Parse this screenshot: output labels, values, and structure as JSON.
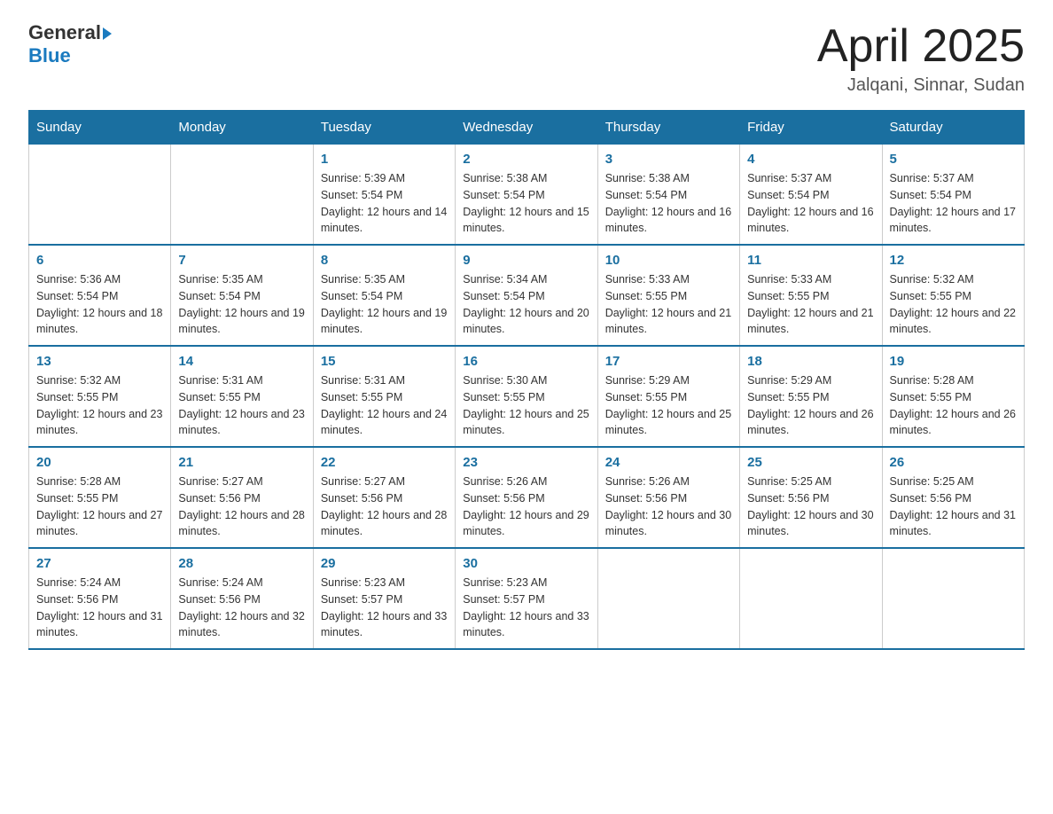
{
  "header": {
    "logo_text_general": "General",
    "logo_text_blue": "Blue",
    "main_title": "April 2025",
    "subtitle": "Jalqani, Sinnar, Sudan"
  },
  "calendar": {
    "days_of_week": [
      "Sunday",
      "Monday",
      "Tuesday",
      "Wednesday",
      "Thursday",
      "Friday",
      "Saturday"
    ],
    "weeks": [
      [
        {
          "day": "",
          "info": ""
        },
        {
          "day": "",
          "info": ""
        },
        {
          "day": "1",
          "sunrise": "5:39 AM",
          "sunset": "5:54 PM",
          "daylight": "12 hours and 14 minutes."
        },
        {
          "day": "2",
          "sunrise": "5:38 AM",
          "sunset": "5:54 PM",
          "daylight": "12 hours and 15 minutes."
        },
        {
          "day": "3",
          "sunrise": "5:38 AM",
          "sunset": "5:54 PM",
          "daylight": "12 hours and 16 minutes."
        },
        {
          "day": "4",
          "sunrise": "5:37 AM",
          "sunset": "5:54 PM",
          "daylight": "12 hours and 16 minutes."
        },
        {
          "day": "5",
          "sunrise": "5:37 AM",
          "sunset": "5:54 PM",
          "daylight": "12 hours and 17 minutes."
        }
      ],
      [
        {
          "day": "6",
          "sunrise": "5:36 AM",
          "sunset": "5:54 PM",
          "daylight": "12 hours and 18 minutes."
        },
        {
          "day": "7",
          "sunrise": "5:35 AM",
          "sunset": "5:54 PM",
          "daylight": "12 hours and 19 minutes."
        },
        {
          "day": "8",
          "sunrise": "5:35 AM",
          "sunset": "5:54 PM",
          "daylight": "12 hours and 19 minutes."
        },
        {
          "day": "9",
          "sunrise": "5:34 AM",
          "sunset": "5:54 PM",
          "daylight": "12 hours and 20 minutes."
        },
        {
          "day": "10",
          "sunrise": "5:33 AM",
          "sunset": "5:55 PM",
          "daylight": "12 hours and 21 minutes."
        },
        {
          "day": "11",
          "sunrise": "5:33 AM",
          "sunset": "5:55 PM",
          "daylight": "12 hours and 21 minutes."
        },
        {
          "day": "12",
          "sunrise": "5:32 AM",
          "sunset": "5:55 PM",
          "daylight": "12 hours and 22 minutes."
        }
      ],
      [
        {
          "day": "13",
          "sunrise": "5:32 AM",
          "sunset": "5:55 PM",
          "daylight": "12 hours and 23 minutes."
        },
        {
          "day": "14",
          "sunrise": "5:31 AM",
          "sunset": "5:55 PM",
          "daylight": "12 hours and 23 minutes."
        },
        {
          "day": "15",
          "sunrise": "5:31 AM",
          "sunset": "5:55 PM",
          "daylight": "12 hours and 24 minutes."
        },
        {
          "day": "16",
          "sunrise": "5:30 AM",
          "sunset": "5:55 PM",
          "daylight": "12 hours and 25 minutes."
        },
        {
          "day": "17",
          "sunrise": "5:29 AM",
          "sunset": "5:55 PM",
          "daylight": "12 hours and 25 minutes."
        },
        {
          "day": "18",
          "sunrise": "5:29 AM",
          "sunset": "5:55 PM",
          "daylight": "12 hours and 26 minutes."
        },
        {
          "day": "19",
          "sunrise": "5:28 AM",
          "sunset": "5:55 PM",
          "daylight": "12 hours and 26 minutes."
        }
      ],
      [
        {
          "day": "20",
          "sunrise": "5:28 AM",
          "sunset": "5:55 PM",
          "daylight": "12 hours and 27 minutes."
        },
        {
          "day": "21",
          "sunrise": "5:27 AM",
          "sunset": "5:56 PM",
          "daylight": "12 hours and 28 minutes."
        },
        {
          "day": "22",
          "sunrise": "5:27 AM",
          "sunset": "5:56 PM",
          "daylight": "12 hours and 28 minutes."
        },
        {
          "day": "23",
          "sunrise": "5:26 AM",
          "sunset": "5:56 PM",
          "daylight": "12 hours and 29 minutes."
        },
        {
          "day": "24",
          "sunrise": "5:26 AM",
          "sunset": "5:56 PM",
          "daylight": "12 hours and 30 minutes."
        },
        {
          "day": "25",
          "sunrise": "5:25 AM",
          "sunset": "5:56 PM",
          "daylight": "12 hours and 30 minutes."
        },
        {
          "day": "26",
          "sunrise": "5:25 AM",
          "sunset": "5:56 PM",
          "daylight": "12 hours and 31 minutes."
        }
      ],
      [
        {
          "day": "27",
          "sunrise": "5:24 AM",
          "sunset": "5:56 PM",
          "daylight": "12 hours and 31 minutes."
        },
        {
          "day": "28",
          "sunrise": "5:24 AM",
          "sunset": "5:56 PM",
          "daylight": "12 hours and 32 minutes."
        },
        {
          "day": "29",
          "sunrise": "5:23 AM",
          "sunset": "5:57 PM",
          "daylight": "12 hours and 33 minutes."
        },
        {
          "day": "30",
          "sunrise": "5:23 AM",
          "sunset": "5:57 PM",
          "daylight": "12 hours and 33 minutes."
        },
        {
          "day": "",
          "info": ""
        },
        {
          "day": "",
          "info": ""
        },
        {
          "day": "",
          "info": ""
        }
      ]
    ]
  }
}
